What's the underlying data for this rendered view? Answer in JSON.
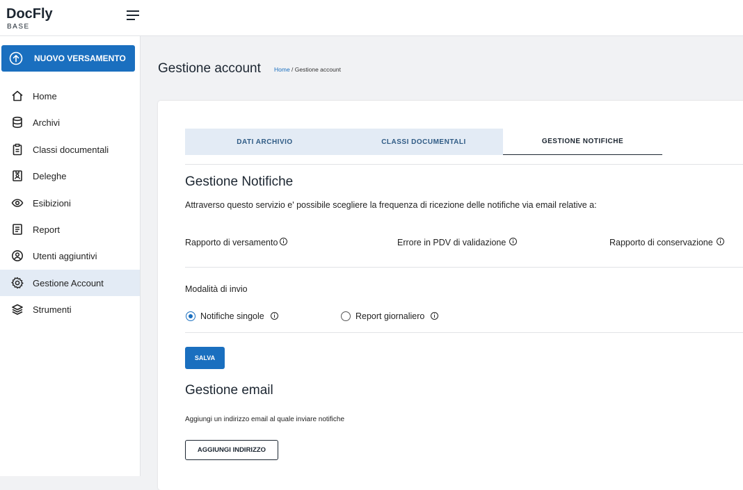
{
  "header": {
    "logo_name": "DocFly",
    "logo_sub": "BASE"
  },
  "sidebar": {
    "cta_label": "NUOVO VERSAMENTO",
    "items": [
      {
        "label": "Home",
        "icon": "home-icon"
      },
      {
        "label": "Archivi",
        "icon": "database-icon"
      },
      {
        "label": "Classi documentali",
        "icon": "clipboard-icon"
      },
      {
        "label": "Deleghe",
        "icon": "id-badge-icon"
      },
      {
        "label": "Esibizioni",
        "icon": "eye-icon"
      },
      {
        "label": "Report",
        "icon": "report-icon"
      },
      {
        "label": "Utenti aggiuntivi",
        "icon": "user-circle-icon"
      },
      {
        "label": "Gestione Account",
        "icon": "gear-icon",
        "active": true
      },
      {
        "label": "Strumenti",
        "icon": "layers-icon"
      }
    ]
  },
  "page": {
    "title": "Gestione account",
    "breadcrumb_home": "Home",
    "breadcrumb_sep": " / ",
    "breadcrumb_current": "Gestione account"
  },
  "tabs": [
    {
      "label": "DATI ARCHIVIO"
    },
    {
      "label": "CLASSI DOCUMENTALI"
    },
    {
      "label": "GESTIONE NOTIFICHE",
      "active": true
    }
  ],
  "notifications": {
    "heading": "Gestione Notifiche",
    "description": "Attraverso questo servizio e' possibile scegliere la frequenza di ricezione delle notifiche via email relative a:",
    "types": [
      "Rapporto di versamento",
      "Errore in PDV di validazione",
      "Rapporto di conservazione"
    ],
    "mode_label": "Modalità di invio",
    "options": [
      {
        "label": "Notifiche singole",
        "checked": true
      },
      {
        "label": "Report giornaliero",
        "checked": false
      }
    ],
    "save_label": "SALVA"
  },
  "email": {
    "heading": "Gestione email",
    "description": "Aggiungi un indirizzo email al quale inviare notifiche",
    "add_label": "AGGIUNGI INDIRIZZO"
  },
  "colors": {
    "accent": "#1a6fbf",
    "active_bg": "#e3ebf5",
    "page_bg": "#f1f2f4"
  }
}
